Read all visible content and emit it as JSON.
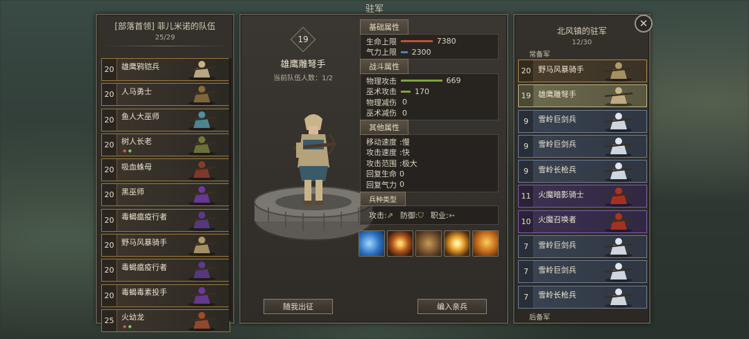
{
  "screen_title": "驻军",
  "left_panel": {
    "title": "[部落首领] 菲儿米诺的队伍",
    "count": "25/29",
    "units": [
      {
        "level": "20",
        "name": "雄鹰鸦铠兵",
        "gems": "",
        "color": "#c9b48a"
      },
      {
        "level": "20",
        "name": "人马勇士",
        "gems": "",
        "color": "#8a6a3c"
      },
      {
        "level": "20",
        "name": "鱼人大巫师",
        "gems": "",
        "color": "#4f8fa0"
      },
      {
        "level": "20",
        "name": "树人长老",
        "gems": "rg",
        "color": "#6f7a3a"
      },
      {
        "level": "20",
        "name": "吸血蛛母",
        "gems": "",
        "color": "#8a3a2a"
      },
      {
        "level": "20",
        "name": "黑巫师",
        "gems": "",
        "color": "#6a3aa0"
      },
      {
        "level": "20",
        "name": "毒蝎瘟疫行者",
        "gems": "",
        "color": "#5a3a8a"
      },
      {
        "level": "20",
        "name": "野马风暴骑手",
        "gems": "",
        "color": "#b09a6a"
      },
      {
        "level": "20",
        "name": "毒蝎瘟疫行者",
        "gems": "",
        "color": "#5a3a8a"
      },
      {
        "level": "20",
        "name": "毒蝎毒素投手",
        "gems": "",
        "color": "#6a3a9a"
      },
      {
        "level": "25",
        "name": "火幼龙",
        "gems": "rg",
        "color": "#a04a2a"
      }
    ]
  },
  "center_panel": {
    "level": "19",
    "unit_name": "雄鹰雕弩手",
    "party_count": "当前队伍人数：1/2",
    "base_attrs": {
      "tab": "基础属性",
      "hp_label": "生命上限",
      "hp_value": "7380",
      "hp_fraction": 0.95,
      "mp_label": "气力上限",
      "mp_value": "2300",
      "mp_fraction": 0.2
    },
    "combat_attrs": {
      "tab": "战斗属性",
      "patk_label": "物理攻击",
      "patk_value": "669",
      "patk_fraction": 0.85,
      "matk_label": "巫术攻击",
      "matk_value": "170",
      "matk_fraction": 0.2,
      "pdef_label": "物理减伤",
      "pdef_value": "0",
      "mdef_label": "巫术减伤",
      "mdef_value": "0"
    },
    "other_attrs": {
      "tab": "其他属性",
      "rows": [
        {
          "label": "移动速度",
          "value": ":慢"
        },
        {
          "label": "攻击速度",
          "value": ":快"
        },
        {
          "label": "攻击范围",
          "value": ":极大"
        },
        {
          "label": "回复生命",
          "value": "0"
        },
        {
          "label": "回复气力",
          "value": "0"
        }
      ]
    },
    "unit_type": {
      "tab": "兵种类型",
      "attack_label": "攻击:",
      "defense_label": "防御:",
      "class_label": "职业:"
    },
    "skills": [
      "wind-slash-icon",
      "golden-ring-icon",
      "fist-icon",
      "sun-burst-icon",
      "orb-explosion-icon"
    ],
    "deploy_button": "随我出征",
    "guard_button": "编入亲兵"
  },
  "right_panel": {
    "title": "北风镇的驻军",
    "count": "12/30",
    "section_regular": "常备军",
    "section_reserve": "后备军",
    "units": [
      {
        "level": "20",
        "name": "野马风暴骑手",
        "style": "gold"
      },
      {
        "level": "19",
        "name": "雄鹰雕弩手",
        "style": "sel"
      },
      {
        "level": "9",
        "name": "雪岭巨剑兵",
        "style": "blue"
      },
      {
        "level": "9",
        "name": "雪岭巨剑兵",
        "style": "blue"
      },
      {
        "level": "9",
        "name": "雪岭长枪兵",
        "style": "blue"
      },
      {
        "level": "11",
        "name": "火魔暗影骑士",
        "style": "purple"
      },
      {
        "level": "10",
        "name": "火魔召唤者",
        "style": "purple"
      },
      {
        "level": "7",
        "name": "雪岭巨剑兵",
        "style": "blue"
      },
      {
        "level": "7",
        "name": "雪岭巨剑兵",
        "style": "blue"
      },
      {
        "level": "7",
        "name": "雪岭长枪兵",
        "style": "blue"
      }
    ]
  }
}
